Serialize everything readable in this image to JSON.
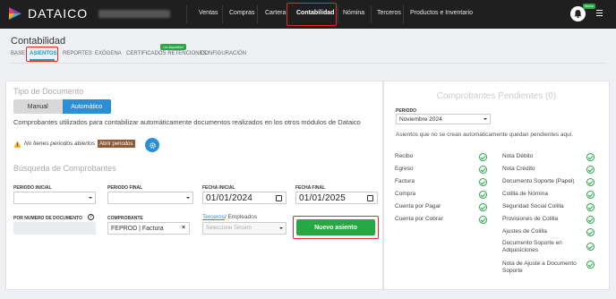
{
  "app": {
    "brand": "DATAICO",
    "nav": [
      "Ventas",
      "Compras",
      "Cartera",
      "Contabilidad",
      "Nómina",
      "Terceros",
      "Productos e Inventario"
    ],
    "active_nav": "Contabilidad",
    "notif_badge": "Nuevo"
  },
  "page": {
    "title": "Contabilidad",
    "tabs": [
      "BASE",
      "ASIENTOS",
      "REPORTES",
      "EXÓGENA",
      "CERTIFICADOS RETENCIONES",
      "CONFIGURACIÓN"
    ],
    "active_tab": "ASIENTOS",
    "new_badge": "¡Ya disponible!"
  },
  "tipo_documento": {
    "title": "Tipo de Documento",
    "manual": "Manual",
    "automatico": "Automático",
    "description": "Comprobantes utilizados para contabilizar automáticamente documentos realizados en los otros módulos de Dataico",
    "warning": "No tienes periodos abiertos",
    "open_periods": "Abrir periodos"
  },
  "busqueda": {
    "title": "Búsqueda de Comprobantes",
    "periodo_inicial": "PERIODO INICIAL",
    "periodo_final": "PERIODO FINAL",
    "fecha_inicial": "FECHA INICIAL",
    "fecha_inicial_value": "01/01/2024",
    "fecha_final": "FECHA FINAL",
    "fecha_final_value": "01/01/2025",
    "numero_documento": "POR NUMERO DE DOCUMENTO",
    "comprobante": "COMPROBANTE",
    "comprobante_value": "FEPROD | Factura",
    "terceros_link": "Terceros",
    "empleados": "/ Empleados",
    "tercero_placeholder": "Seleccione Tercero",
    "nuevo_asiento": "Nuevo asiento"
  },
  "pendientes": {
    "title": "Comprobantes Pendientes (0)",
    "periodo_label": "PERIODO",
    "periodo_value": "Noviembre 2024",
    "note": "Asientos que no se crean automáticamente quedan pendientes aquí.",
    "left_items": [
      "Recibo",
      "Egreso",
      "Factura",
      "Compra",
      "Cuenta por Pagar",
      "Cuenta por Cobrar"
    ],
    "right_items": [
      "Nota Débito",
      "Nota Crédito",
      "Documento Soporte (Papel)",
      "Colilla de Nómina",
      "Seguridad Social Colilla",
      "Provisiones de Colilla",
      "Ajustes de Colilla",
      "Documento Soporte en Adquisiciones",
      "Nota de Ajuste a Documento Soporte"
    ]
  },
  "colors": {
    "accent": "#2b8fd6",
    "success": "#28a745",
    "highlight": "#e02b2b",
    "topbar": "#1f1f1f"
  }
}
